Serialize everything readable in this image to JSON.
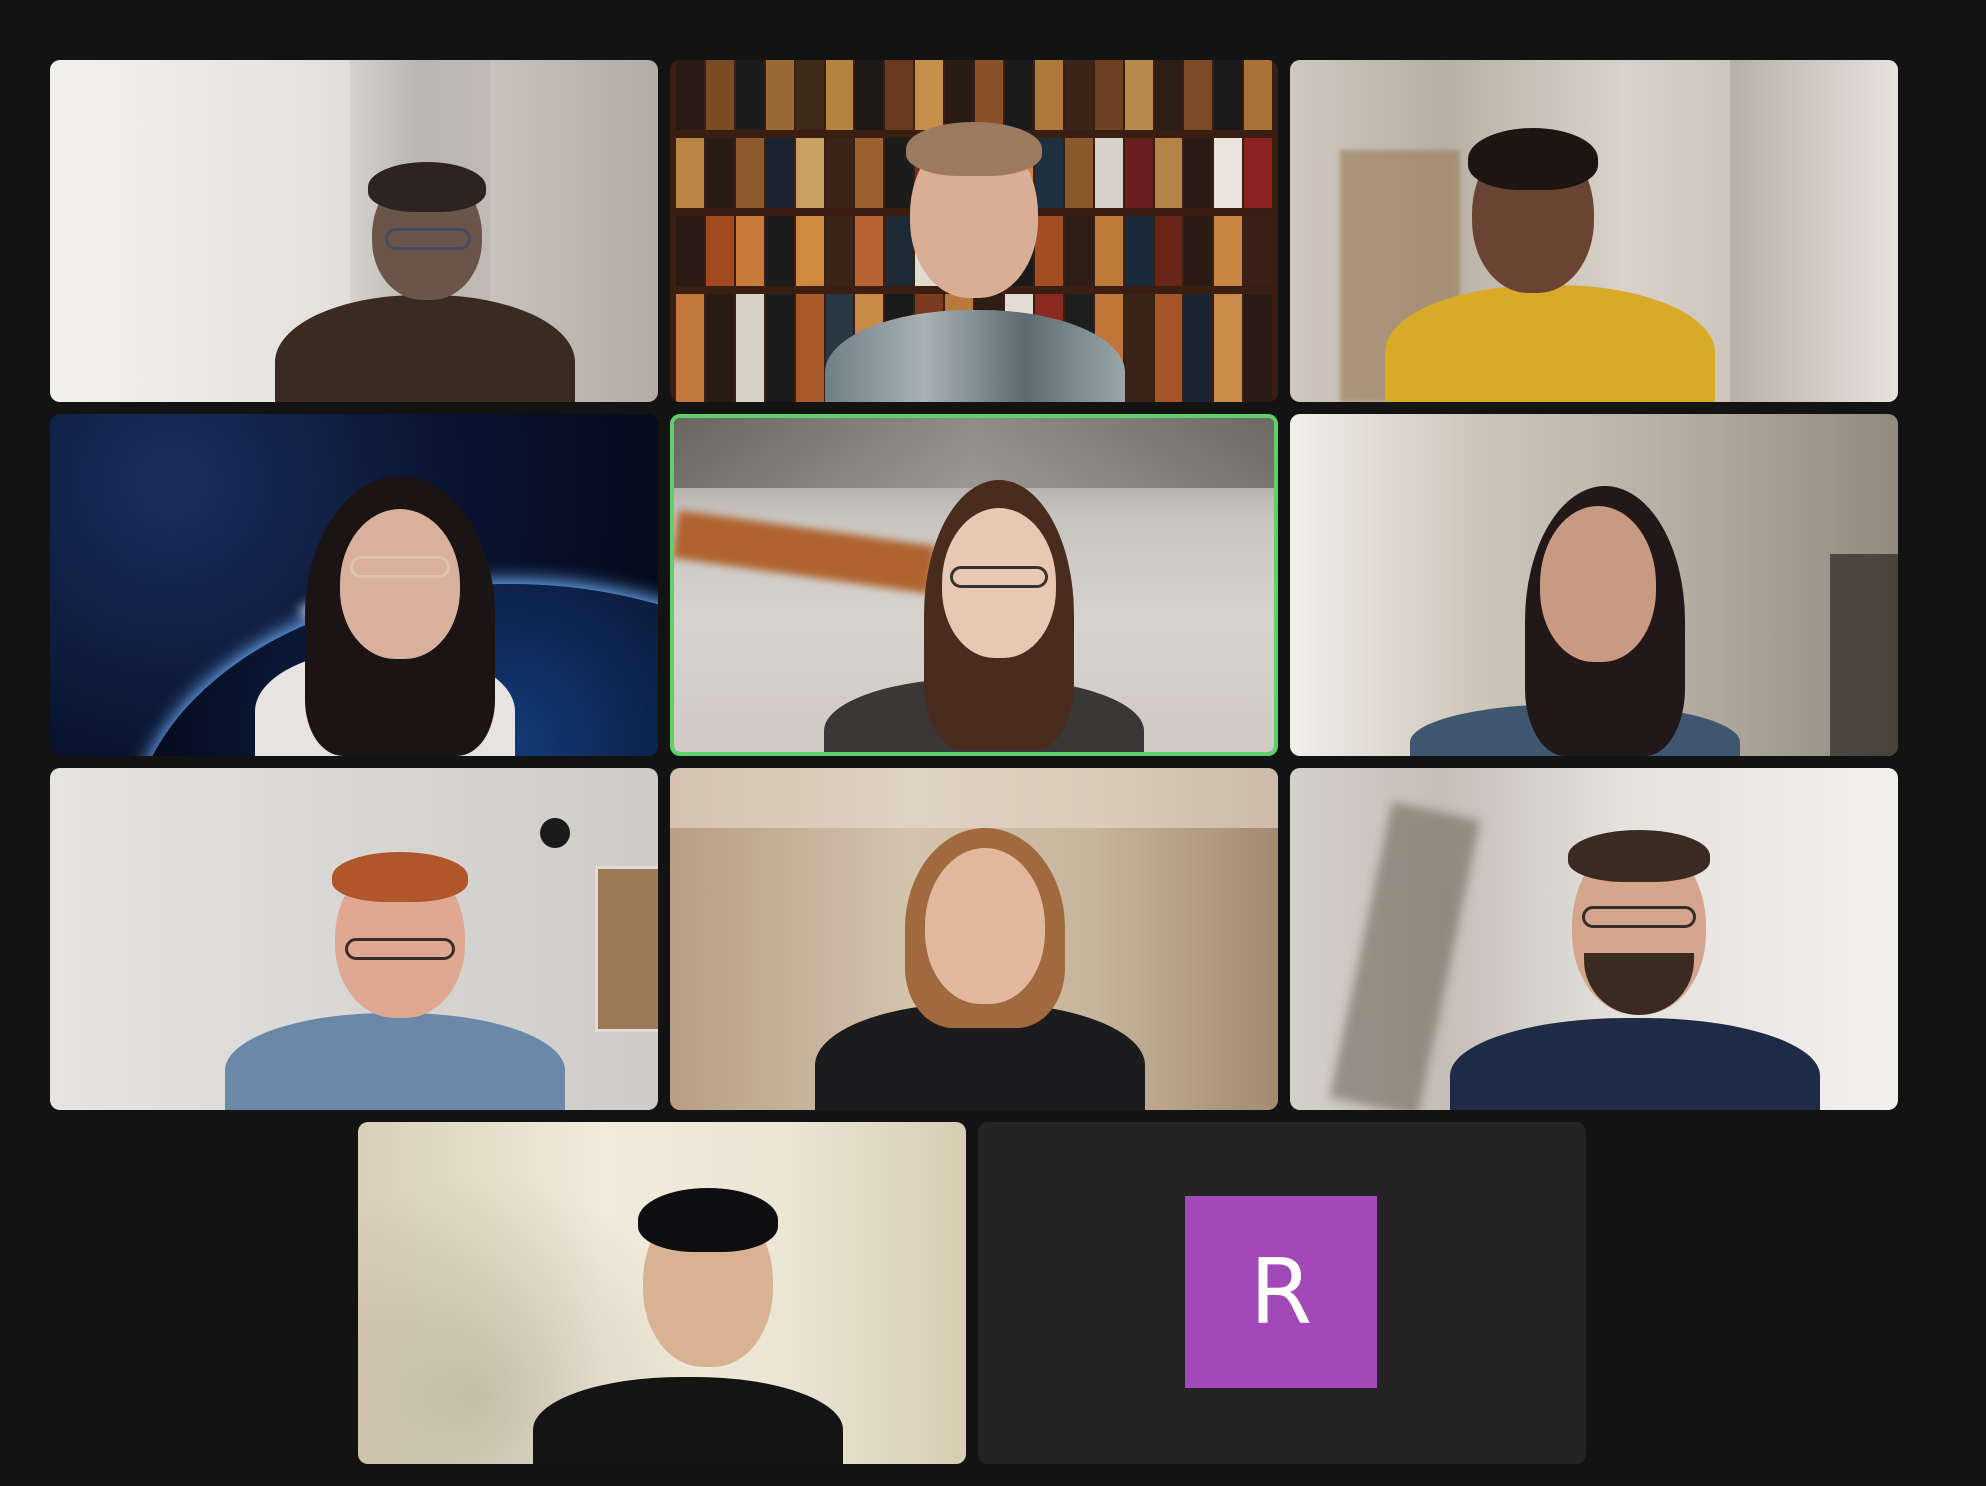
{
  "meeting": {
    "view": "gallery",
    "participants": [
      {
        "id": "p1",
        "has_video": true,
        "bg": "#d9d6d2",
        "speaking": false
      },
      {
        "id": "p2",
        "has_video": true,
        "bg": "#4a2a1c",
        "speaking": false
      },
      {
        "id": "p3",
        "has_video": true,
        "bg": "#cfc8bf",
        "speaking": false
      },
      {
        "id": "p4",
        "has_video": true,
        "bg": "#0d1a3a",
        "speaking": false
      },
      {
        "id": "p5",
        "has_video": true,
        "bg": "#bdb6ad",
        "speaking": true
      },
      {
        "id": "p6",
        "has_video": true,
        "bg": "#c8c1b5",
        "speaking": false
      },
      {
        "id": "p7",
        "has_video": true,
        "bg": "#dcdad6",
        "speaking": false
      },
      {
        "id": "p8",
        "has_video": true,
        "bg": "#cdbba4",
        "speaking": false
      },
      {
        "id": "p9",
        "has_video": true,
        "bg": "#d8d3cc",
        "speaking": false
      },
      {
        "id": "p10",
        "has_video": true,
        "bg": "#e8e2d2",
        "speaking": false
      },
      {
        "id": "p11",
        "has_video": false,
        "avatar_initial": "R",
        "avatar_color": "#a348b8"
      }
    ]
  },
  "colors": {
    "window_bg": "#131313",
    "tile_bg": "#242424",
    "active_speaker_border": "#5ed06a"
  }
}
